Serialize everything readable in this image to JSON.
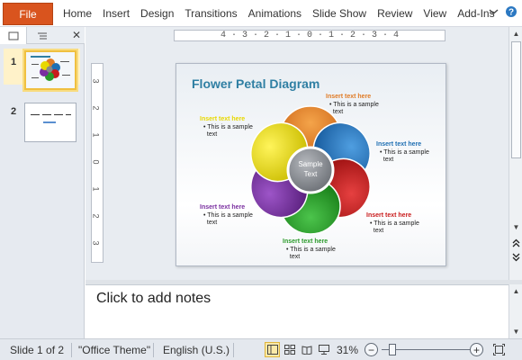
{
  "ribbon": {
    "file_label": "File",
    "tabs": [
      "Home",
      "Insert",
      "Design",
      "Transitions",
      "Animations",
      "Slide Show",
      "Review",
      "View",
      "Add-Ins"
    ]
  },
  "left_panel": {
    "slides": [
      {
        "number": "1"
      },
      {
        "number": "2"
      }
    ]
  },
  "ruler": {
    "h_ticks": "4 · 3 · 2 · 1 · 0 · 1 · 2 · 3 · 4",
    "v_ticks": [
      "3",
      "2",
      "1",
      "0",
      "1",
      "2",
      "3"
    ]
  },
  "slide": {
    "title": "Flower Petal Diagram",
    "center_text": [
      "Sample",
      "Text"
    ],
    "items": [
      {
        "heading": "Insert text here",
        "bullet": "This is a sample",
        "bullet2": "text",
        "color": "#e07b26"
      },
      {
        "heading": "Insert text here",
        "bullet": "This is a sample",
        "bullet2": "text",
        "color": "#1f6fb3"
      },
      {
        "heading": "Insert text here",
        "bullet": "This is a sample",
        "bullet2": "text",
        "color": "#c91b1b"
      },
      {
        "heading": "Insert text here",
        "bullet": "This is a sample",
        "bullet2": "text",
        "color": "#2a9a2a"
      },
      {
        "heading": "Insert text here",
        "bullet": "This is a sample",
        "bullet2": "text",
        "color": "#7a2fa0"
      },
      {
        "heading": "Insert text here",
        "bullet": "This is a sample",
        "bullet2": "text",
        "color": "#e8d800"
      }
    ]
  },
  "notes": {
    "placeholder": "Click to add notes"
  },
  "status": {
    "slide_info": "Slide 1 of 2",
    "theme": "\"Office Theme\"",
    "language": "English (U.S.)",
    "zoom": "31%"
  }
}
